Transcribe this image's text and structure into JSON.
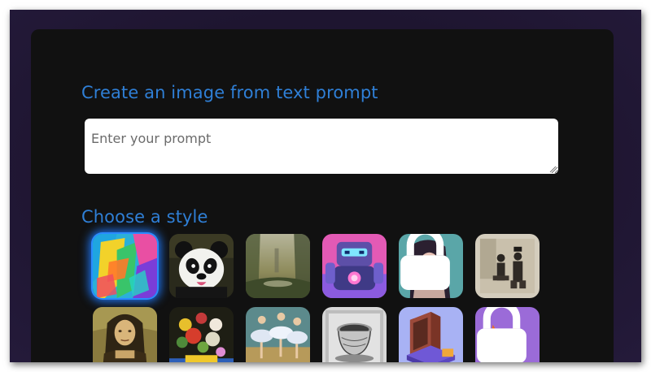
{
  "create": {
    "title": "Create an image from text prompt",
    "prompt_placeholder": "Enter your prompt",
    "prompt_value": ""
  },
  "styles": {
    "title": "Choose a style",
    "items": [
      {
        "name": "abstract-colorful",
        "locked": false,
        "selected": true
      },
      {
        "name": "panda",
        "locked": false,
        "selected": false
      },
      {
        "name": "misty-landscape",
        "locked": false,
        "selected": false
      },
      {
        "name": "robot",
        "locked": false,
        "selected": false
      },
      {
        "name": "woman-portrait",
        "locked": true,
        "selected": false
      },
      {
        "name": "vintage-photo",
        "locked": false,
        "selected": false
      },
      {
        "name": "mona-lisa",
        "locked": false,
        "selected": false
      },
      {
        "name": "flower-bouquet",
        "locked": false,
        "selected": false
      },
      {
        "name": "ballet-dancers",
        "locked": false,
        "selected": false
      },
      {
        "name": "engraving-cup",
        "locked": false,
        "selected": false
      },
      {
        "name": "isometric-3d",
        "locked": false,
        "selected": false
      },
      {
        "name": "cartoon-fox",
        "locked": true,
        "selected": false
      }
    ]
  },
  "colors": {
    "accent": "#2f7fd6",
    "panel": "#111111",
    "background": "#1e1530",
    "selected_glow": "#1f7bff"
  }
}
